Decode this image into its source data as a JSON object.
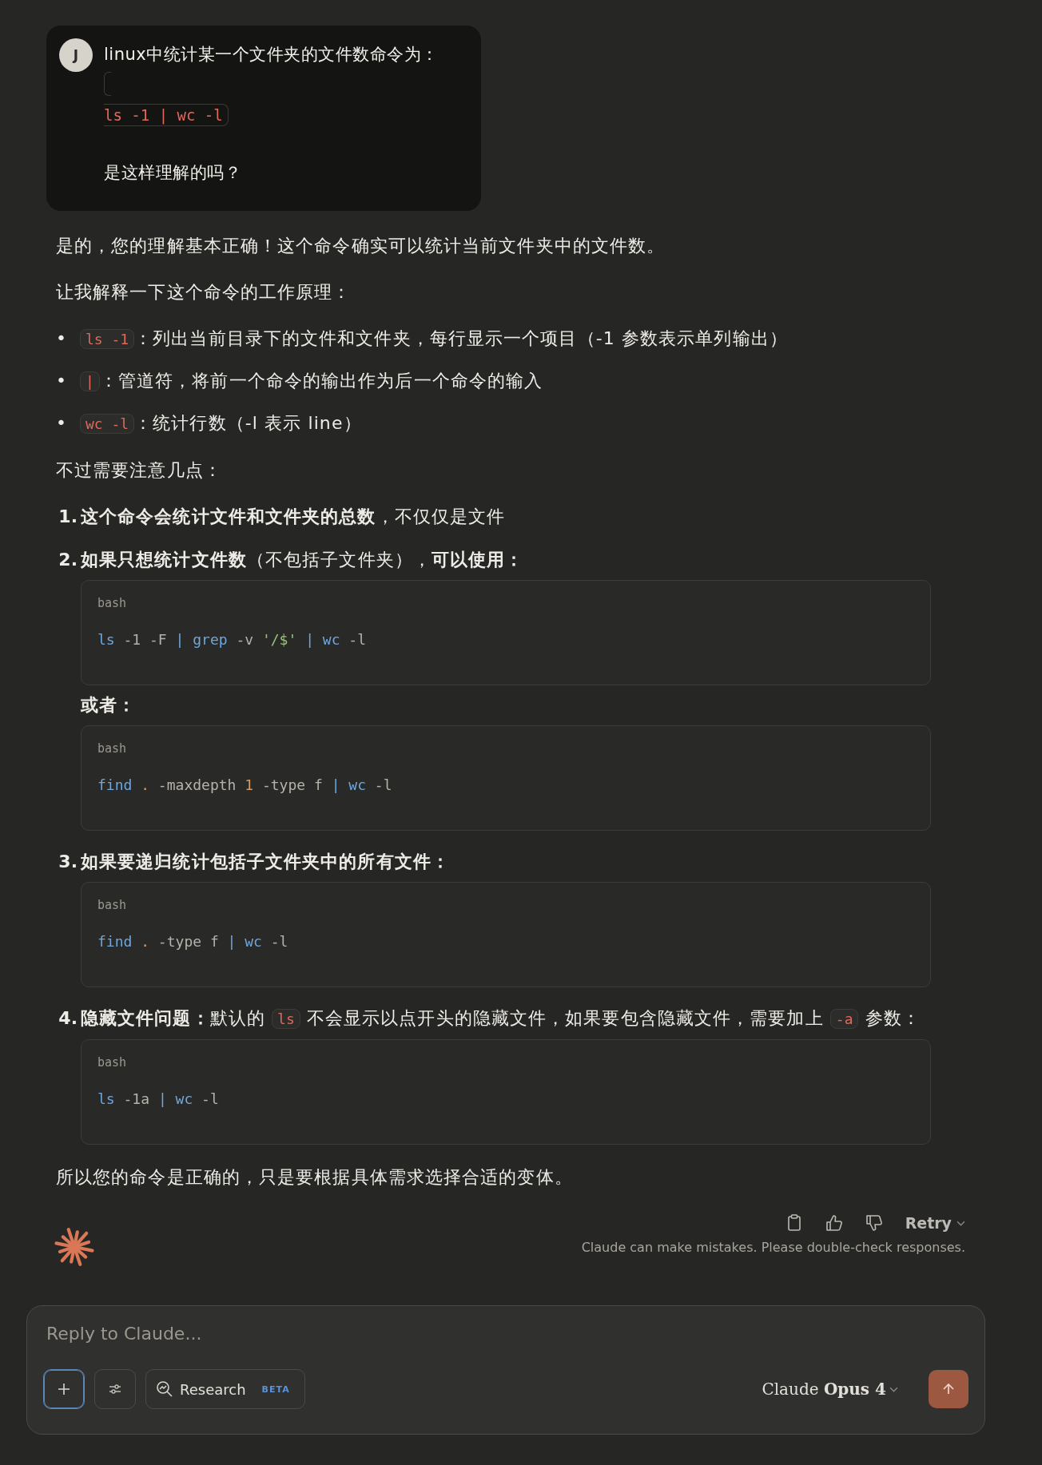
{
  "user_message": {
    "avatar": "J",
    "intro": "linux中统计某一个文件夹的文件数命令为：",
    "code": "ls -1 | wc -l",
    "question": "是这样理解的吗？"
  },
  "response": [
    {
      "kind": "para",
      "segments": [
        {
          "kind": "text",
          "text": "是的，您的理解基本正确！这个命令确实可以统计当前文件夹中的文件数。"
        }
      ]
    },
    {
      "kind": "para",
      "segments": [
        {
          "kind": "text",
          "text": "让我解释一下这个命令的工作原理："
        }
      ]
    },
    {
      "kind": "bullets",
      "items": [
        {
          "marker": "•",
          "segments": [
            {
              "kind": "code",
              "text": "ls -1"
            },
            {
              "kind": "text",
              "text": "：列出当前目录下的文件和文件夹，每行显示一个项目（-1 参数表示单列输出）"
            }
          ]
        },
        {
          "marker": "•",
          "segments": [
            {
              "kind": "code",
              "text": "|"
            },
            {
              "kind": "text",
              "text": "：管道符，将前一个命令的输出作为后一个命令的输入"
            }
          ]
        },
        {
          "marker": "•",
          "segments": [
            {
              "kind": "code",
              "text": "wc -l"
            },
            {
              "kind": "text",
              "text": "：统计行数（-l 表示 line）"
            }
          ]
        }
      ]
    },
    {
      "kind": "para",
      "segments": [
        {
          "kind": "text",
          "text": "不过需要注意几点："
        }
      ]
    },
    {
      "kind": "ordered",
      "items": [
        {
          "number": "1.",
          "segments": [
            {
              "kind": "bold",
              "text": "这个命令会统计文件和文件夹的总数"
            },
            {
              "kind": "text",
              "text": "，不仅仅是文件"
            }
          ]
        },
        {
          "number": "2.",
          "segments": [
            {
              "kind": "bold",
              "text": "如果只想统计文件数"
            },
            {
              "kind": "text",
              "text": "（不包括子文件夹），"
            },
            {
              "kind": "bold",
              "text": "可以使用："
            }
          ],
          "children": [
            {
              "kind": "codeblock",
              "language": "bash",
              "tokens": [
                {
                  "kind": "cmd",
                  "text": "ls"
                },
                {
                  "kind": "plain",
                  "text": " -1 -F "
                },
                {
                  "kind": "cmd",
                  "text": "| grep"
                },
                {
                  "kind": "plain",
                  "text": " -v "
                },
                {
                  "kind": "str",
                  "text": "'/$' "
                },
                {
                  "kind": "cmd",
                  "text": "| wc"
                },
                {
                  "kind": "plain",
                  "text": " -l"
                }
              ]
            },
            {
              "kind": "para",
              "segments": [
                {
                  "kind": "bold",
                  "text": "或者："
                }
              ]
            },
            {
              "kind": "codeblock",
              "language": "bash",
              "tokens": [
                {
                  "kind": "cmd",
                  "text": "find "
                },
                {
                  "kind": "num",
                  "text": "."
                },
                {
                  "kind": "plain",
                  "text": " -maxdepth "
                },
                {
                  "kind": "num",
                  "text": "1"
                },
                {
                  "kind": "plain",
                  "text": " -type f "
                },
                {
                  "kind": "cmd",
                  "text": "| wc"
                },
                {
                  "kind": "plain",
                  "text": " -l"
                }
              ]
            }
          ]
        },
        {
          "number": "3.",
          "segments": [
            {
              "kind": "bold",
              "text": "如果要递归统计包括子文件夹中的所有文件："
            }
          ],
          "children": [
            {
              "kind": "codeblock",
              "language": "bash",
              "tokens": [
                {
                  "kind": "cmd",
                  "text": "find "
                },
                {
                  "kind": "num",
                  "text": "."
                },
                {
                  "kind": "plain",
                  "text": " -type f "
                },
                {
                  "kind": "cmd",
                  "text": "| wc"
                },
                {
                  "kind": "plain",
                  "text": " -l"
                }
              ]
            }
          ]
        },
        {
          "number": "4.",
          "segments": [
            {
              "kind": "bold",
              "text": "隐藏文件问题："
            },
            {
              "kind": "text",
              "text": "默认的 "
            },
            {
              "kind": "code",
              "text": "ls"
            },
            {
              "kind": "text",
              "text": " 不会显示以点开头的隐藏文件，如果要包含隐藏文件，需要加上 "
            },
            {
              "kind": "code",
              "text": "-a"
            },
            {
              "kind": "text",
              "text": " 参数："
            }
          ],
          "children": [
            {
              "kind": "codeblock",
              "language": "bash",
              "tokens": [
                {
                  "kind": "cmd",
                  "text": "ls"
                },
                {
                  "kind": "plain",
                  "text": " -1a "
                },
                {
                  "kind": "cmd",
                  "text": "| wc"
                },
                {
                  "kind": "plain",
                  "text": " -l"
                }
              ]
            }
          ]
        }
      ]
    },
    {
      "kind": "para",
      "segments": [
        {
          "kind": "text",
          "text": "所以您的命令是正确的，只是要根据具体需求选择合适的变体。"
        }
      ]
    }
  ],
  "footer": {
    "retry": "Retry",
    "disclaimer": "Claude can make mistakes. Please double-check responses."
  },
  "composer": {
    "placeholder": "Reply to Claude...",
    "research": "Research",
    "badge": "BETA",
    "model": "Claude **Opus 4**"
  }
}
